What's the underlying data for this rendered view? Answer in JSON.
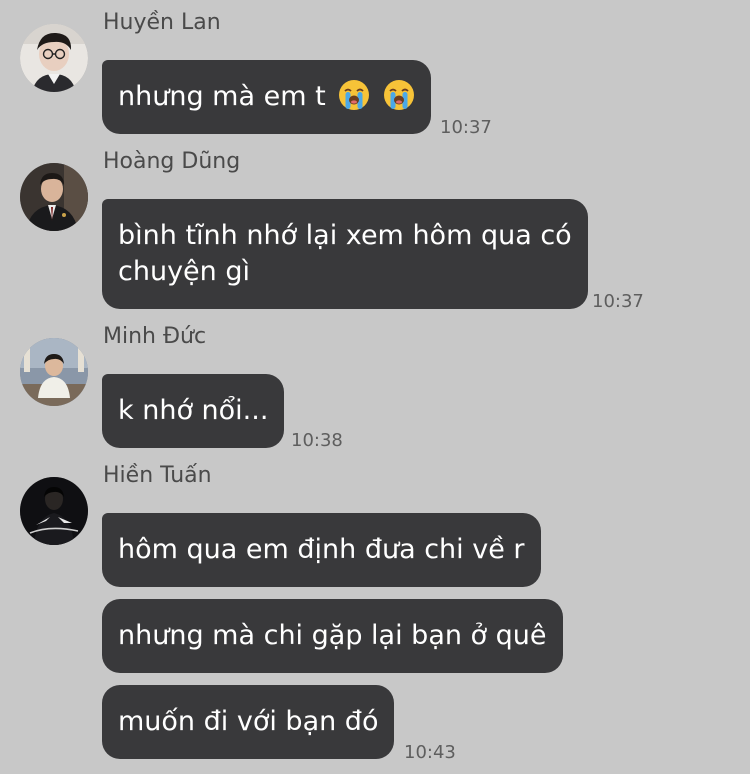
{
  "messages": [
    {
      "sender": "Huyền Lan",
      "avatar": "avatar-huyen-lan",
      "bubbles": [
        "nhưng mà em t"
      ],
      "emoji": [
        "loudly-crying-face-icon",
        "loudly-crying-face-icon"
      ],
      "time": "10:37"
    },
    {
      "sender": "Hoàng Dũng",
      "avatar": "avatar-hoang-dung",
      "bubbles": [
        "bình tĩnh nhớ lại xem hôm qua có",
        "chuyện gì"
      ],
      "time": "10:37"
    },
    {
      "sender": "Minh Đức",
      "avatar": "avatar-minh-duc",
      "bubbles": [
        "k nhớ nổi..."
      ],
      "time": "10:38"
    },
    {
      "sender": "Hiền Tuấn",
      "avatar": "avatar-hien-tuan",
      "bubbles": [
        "hôm qua em định đưa chi về r",
        "nhưng mà chi gặp lại bạn ở quê",
        "muốn đi với bạn đó"
      ],
      "time": "10:43"
    }
  ],
  "colors": {
    "background": "#c8c8c8",
    "bubble": "#39393b",
    "bubble_text": "#ffffff",
    "sender_text": "#4a4a4a",
    "time_text": "#5e5e5e"
  }
}
